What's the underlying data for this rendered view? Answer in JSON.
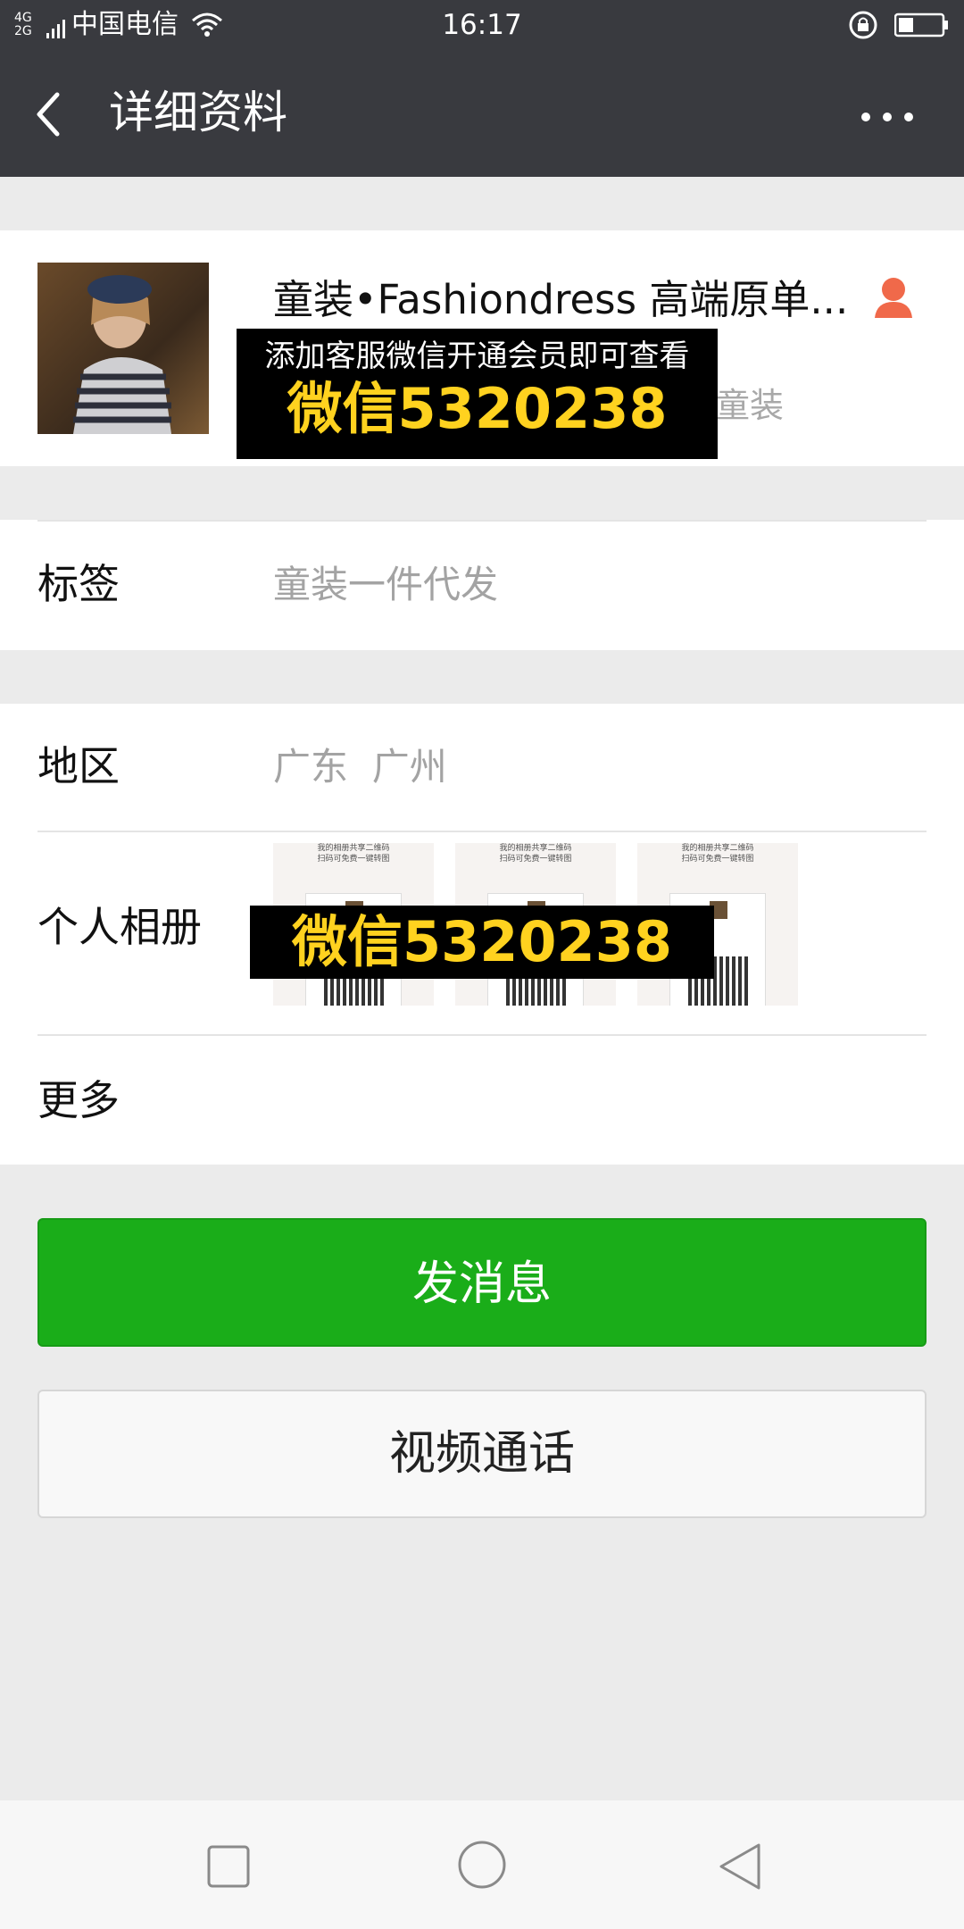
{
  "status_bar": {
    "network_type_top": "4G",
    "network_type_bottom": "2G",
    "carrier": "中国电信",
    "time": "16:17"
  },
  "nav": {
    "title": "详细资料",
    "back_icon": "chevron-left-icon",
    "more_icon": "more-dots-icon"
  },
  "profile": {
    "name": "童装•Fashiondress 高端原单...",
    "subtitle_partial": "童装",
    "badge_icon": "person-orange-icon",
    "badge_color": "#f0694a"
  },
  "watermark_profile": {
    "line1": "添加客服微信开通会员即可查看",
    "line2": "微信5320238"
  },
  "tags": {
    "label": "标签",
    "value": "童装一件代发"
  },
  "region": {
    "label": "地区",
    "value": "广东  广州"
  },
  "album": {
    "label": "个人相册",
    "thumb_line1": "我的相册共享二维码",
    "thumb_line2": "扫码可免费一键转图",
    "watermark": "微信5320238"
  },
  "more": {
    "label": "更多"
  },
  "buttons": {
    "send_message": "发消息",
    "video_call": "视频通话"
  },
  "colors": {
    "nav_bg": "#393a3f",
    "primary_green": "#1aad19",
    "watermark_yellow": "#ffd21f"
  }
}
